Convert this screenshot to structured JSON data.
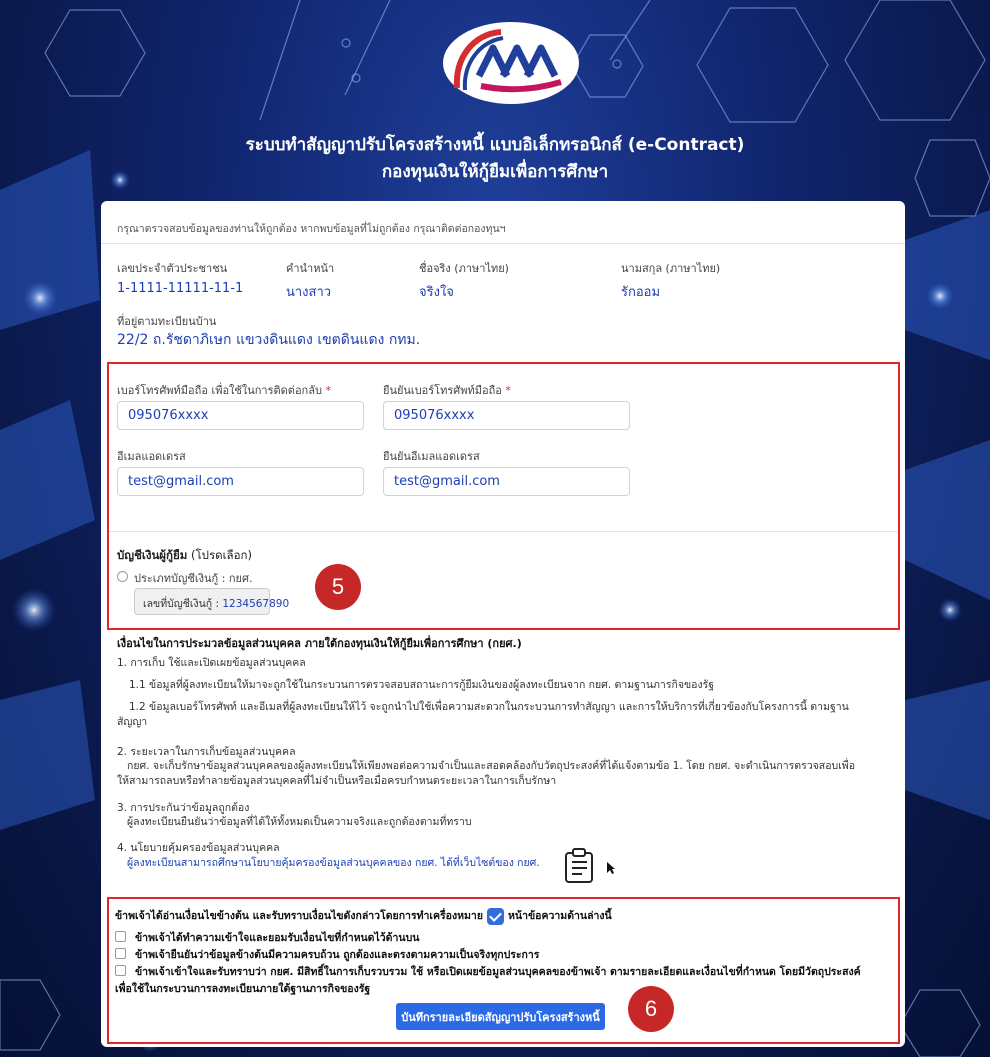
{
  "header": {
    "logo_icon": "ksf-logo",
    "title_line1": "ระบบทำสัญญาปรับโครงสร้างหนี้ แบบอิเล็กทรอนิกส์ (e-Contract)",
    "title_line2": "กองทุนเงินให้กู้ยืมเพื่อการศึกษา"
  },
  "notice": "กรุณาตรวจสอบข้อมูลของท่านให้ถูกต้อง หากพบข้อมูลที่ไม่ถูกต้อง กรุณาติดต่อกองทุนฯ",
  "personal": {
    "id_label": "เลขประจำตัวประชาชน",
    "id_value": "1-1111-11111-11-1",
    "prefix_label": "คำนำหน้า",
    "prefix_value": "นางสาว",
    "firstname_label": "ชื่อจริง (ภาษาไทย)",
    "firstname_value": "จริงใจ",
    "lastname_label": "นามสกุล (ภาษาไทย)",
    "lastname_value": "รักออม",
    "address_label": "ที่อยู่ตามทะเบียนบ้าน",
    "address_value": "22/2 ถ.รัชดาภิเษก แขวงดินแดง เขตดินแดง กทม."
  },
  "contact": {
    "phone_label": "เบอร์โทรศัพท์มือถือ เพื่อใช้ในการติดต่อกลับ",
    "phone_value": "095076xxxx",
    "phone_confirm_label": "ยืนยันเบอร์โทรศัพท์มือถือ",
    "phone_confirm_value": "095076xxxx",
    "email_label": "อีเมลแอดเดรส",
    "email_value": "test@gmail.com",
    "email_confirm_label": "ยืนยันอีเมลแอดเดรส",
    "email_confirm_value": "test@gmail.com",
    "required_mark": "*"
  },
  "bank": {
    "title": "บัญชีเงินผู้กู้ยืม",
    "title_hint": "(โปรดเลือก)",
    "option_label": "ประเภทบัญชีเงินกู้ : กยศ.",
    "account_label": "เลขที่บัญชีเงินกู้ :",
    "account_value": "1234567890"
  },
  "badges": {
    "step5": "5",
    "step6": "6"
  },
  "policy": {
    "heading": "เงื่อนไขในการประมวลข้อมูลส่วนบุคคล ภายใต้กองทุนเงินให้กู้ยืมเพื่อการศึกษา (กยศ.)",
    "s1": "1. การเก็บ ใช้และเปิดเผยข้อมูลส่วนบุคคล",
    "s1_1": "1.1 ข้อมูลที่ผู้ลงทะเบียนให้มาจะถูกใช้ในกระบวนการตรวจสอบสถานะการกู้ยืมเงินของผู้ลงทะเบียนจาก กยศ. ตามฐานภารกิจของรัฐ",
    "s1_2a": "1.2 ข้อมูลเบอร์โทรศัพท์ และอีเมลที่ผู้ลงทะเบียนให้ไว้ จะถูกนำไปใช้เพื่อความสะดวกในกระบวนการทำสัญญา และการให้บริการที่เกี่ยวข้องกับโครงการนี้ ตามฐาน",
    "s1_2b": "สัญญา",
    "s2": "2. ระยะเวลาในการเก็บข้อมูลส่วนบุคคล",
    "s2_a": "กยศ. จะเก็บรักษาข้อมูลส่วนบุคคลของผู้ลงทะเบียนให้เพียงพอต่อความจำเป็นและสอดคล้องกับวัตถุประสงค์ที่ได้แจ้งตามข้อ 1. โดย กยศ. จะดำเนินการตรวจสอบเพื่อ",
    "s2_b": "ให้สามารถลบหรือทำลายข้อมูลส่วนบุคคลที่ไม่จำเป็นหรือเมื่อครบกำหนดระยะเวลาในการเก็บรักษา",
    "s3": "3. การประกันว่าข้อมูลถูกต้อง",
    "s3_a": "ผู้ลงทะเบียนยืนยันว่าข้อมูลที่ได้ให้ทั้งหมดเป็นความจริงและถูกต้องตามที่ทราบ",
    "s4": "4. นโยบายคุ้มครองข้อมูลส่วนบุคคล",
    "s4_link": "ผู้ลงทะเบียนสามารถศึกษานโยบายคุ้มครองข้อมูลส่วนบุคคลของ กยศ. ได้ที่เว็บไซต์ของ กยศ."
  },
  "consent": {
    "intro_a": "ข้าพเจ้าได้อ่านเงื่อนไขข้างต้น และรับทราบเงื่อนไขดังกล่าวโดยการทำเครื่องหมาย",
    "intro_b": "หน้าข้อความด้านล่างนี้",
    "c1": "ข้าพเจ้าได้ทำความเข้าใจและยอมรับเงื่อนไขที่กำหนดไว้ด้านบน",
    "c2": "ข้าพเจ้ายืนยันว่าข้อมูลข้างต้นมีความครบถ้วน ถูกต้องและตรงตามความเป็นจริงทุกประการ",
    "c3a": "ข้าพเจ้าเข้าใจและรับทราบว่า กยศ. มีสิทธิ์ในการเก็บรวบรวม ใช้ หรือเปิดเผยข้อมูลส่วนบุคคลของข้าพเจ้า ตามรายละเอียดและเงื่อนไขที่กำหนด โดยมีวัตถุประสงค์",
    "c3b": "เพื่อใช้ในกระบวนการลงทะเบียนภายใต้ฐานภารกิจของรัฐ",
    "save_label": "บันทึกรายละเอียดสัญญาปรับโครงสร้างหนี้"
  }
}
